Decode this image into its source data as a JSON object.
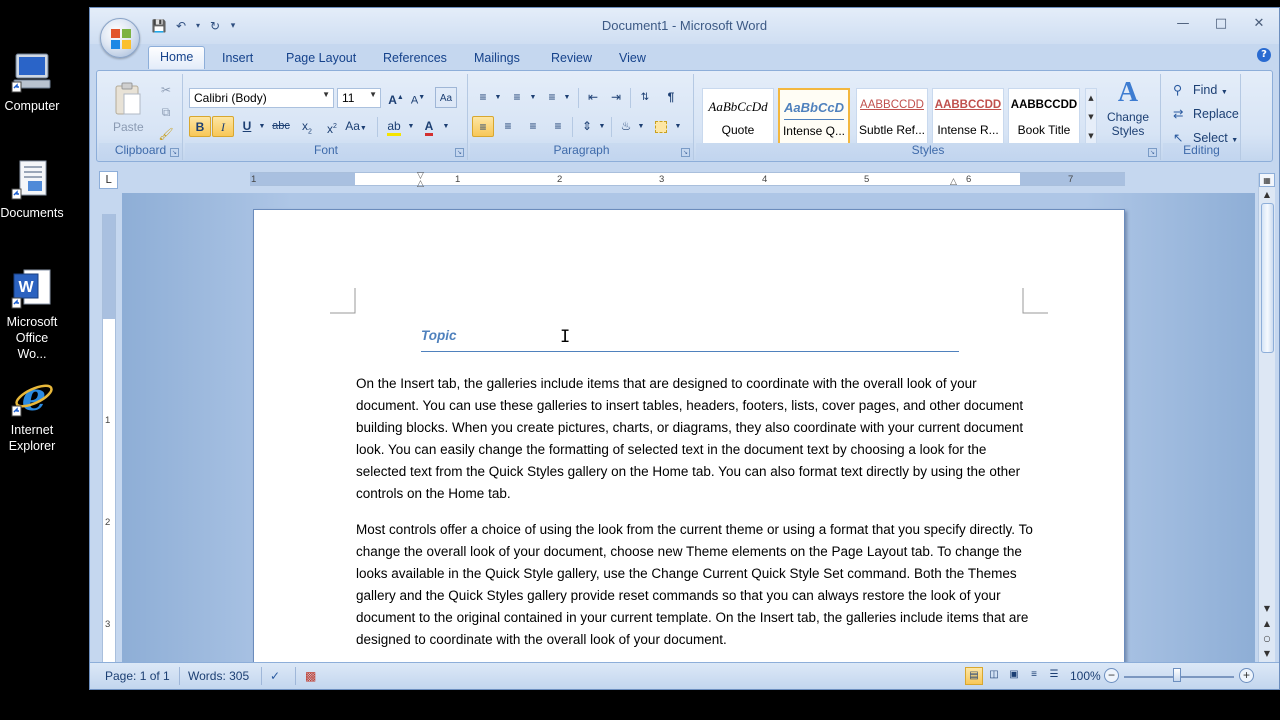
{
  "desktop": {
    "icons": [
      {
        "label": "Computer"
      },
      {
        "label": "Documents"
      },
      {
        "label_line1": "Microsoft",
        "label_line2": "Office Wo..."
      },
      {
        "label_line1": "Internet",
        "label_line2": "Explorer"
      }
    ]
  },
  "window": {
    "title": "Document1 - Microsoft Word",
    "tabs": [
      "Home",
      "Insert",
      "Page Layout",
      "References",
      "Mailings",
      "Review",
      "View"
    ],
    "active_tab": "Home"
  },
  "ribbon": {
    "clipboard": {
      "label": "Clipboard",
      "paste_label": "Paste"
    },
    "font": {
      "label": "Font",
      "font_name": "Calibri (Body)",
      "font_size": "11"
    },
    "paragraph": {
      "label": "Paragraph"
    },
    "styles": {
      "label": "Styles",
      "items": [
        {
          "sample": "AaBbCcDd",
          "name": "Quote"
        },
        {
          "sample": "AaBbCcDd",
          "name": "Intense Q..."
        },
        {
          "sample": "AABBCCDD",
          "name": "Subtle Ref..."
        },
        {
          "sample": "AABBCCDD",
          "name": "Intense R..."
        },
        {
          "sample": "AABBCCDD",
          "name": "Book Title"
        }
      ],
      "change_styles_line1": "Change",
      "change_styles_line2": "Styles"
    },
    "editing": {
      "label": "Editing",
      "find": "Find",
      "replace": "Replace",
      "select": "Select"
    }
  },
  "ruler": {
    "numbers": [
      "1",
      "1",
      "2",
      "3",
      "4",
      "5",
      "6",
      "7"
    ],
    "vnumbers": [
      "1",
      "2",
      "3"
    ]
  },
  "document": {
    "heading": "Topic",
    "paragraphs": [
      "On the Insert tab, the galleries include items that are designed to coordinate with the overall look of your document. You can use these galleries to insert tables, headers, footers, lists, cover pages, and other document building blocks. When you create pictures, charts, or diagrams, they also coordinate with your current document look. You can easily change the formatting of selected text in the document text by choosing a look for the selected text from the Quick Styles gallery on the Home tab. You can also format text directly by using the other controls on the Home tab.",
      "Most controls offer a choice of using the look from the current theme or using a format that you specify directly. To change the overall look of your document, choose new Theme elements on the Page Layout tab. To change the looks available in the Quick Style gallery, use the Change Current Quick Style Set command. Both the Themes gallery and the Quick Styles gallery provide reset commands so that you can always restore the look of your document to the original contained in your current template. On the Insert tab, the galleries include items that are designed to coordinate with the overall look of your document."
    ]
  },
  "status": {
    "page": "Page: 1 of 1",
    "words": "Words: 305",
    "zoom": "100%",
    "zoom_minus": "−",
    "zoom_plus": "+"
  }
}
